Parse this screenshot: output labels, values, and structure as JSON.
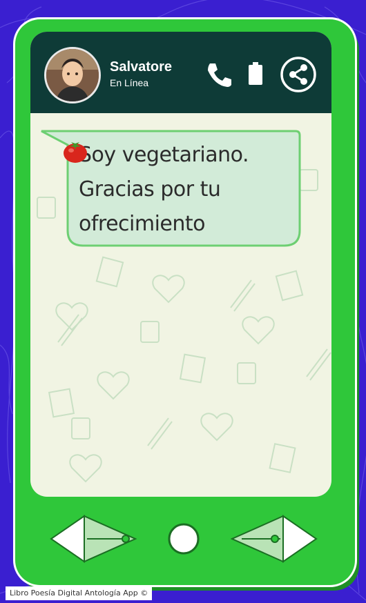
{
  "header": {
    "contact_name": "Salvatore",
    "contact_status": "En Línea",
    "icons": [
      "phone-icon",
      "battery-icon",
      "share-icon"
    ]
  },
  "message": {
    "lines": [
      "Soy vegetariano.",
      "Gracias por tu",
      "ofrecimiento"
    ],
    "emoji": "tomato-icon"
  },
  "navigation": {
    "back": "left-arrow",
    "home": "home-button",
    "forward": "right-arrow"
  },
  "footer": {
    "credit": "Libro Poesía Digital Antología App ©"
  },
  "colors": {
    "background": "#3a1fd0",
    "phone_body": "#2fc73a",
    "header": "#0e3b37",
    "screen": "#f1f4e3",
    "bubble": "#d2ebd8",
    "bubble_border": "#6dcf72"
  }
}
